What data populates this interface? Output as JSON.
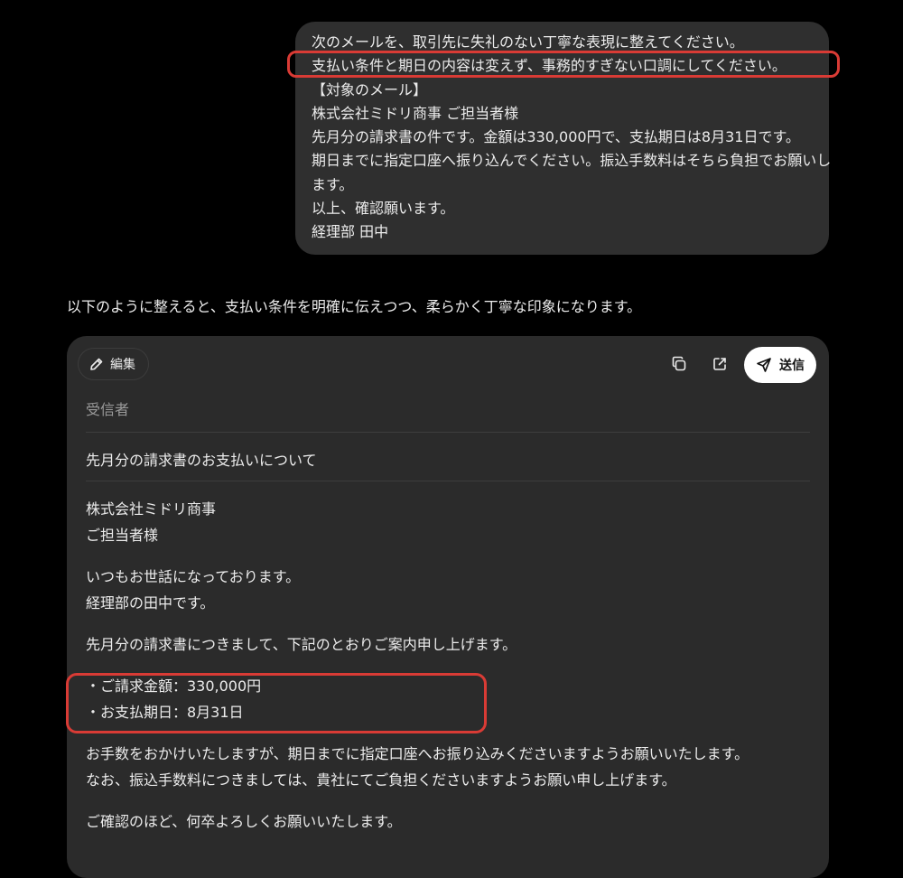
{
  "user_message": {
    "lines": [
      "次のメールを、取引先に失礼のない丁寧な表現に整えてください。",
      "支払い条件と期日の内容は変えず、事務的すぎない口調にしてください。",
      "【対象のメール】",
      "株式会社ミドリ商事 ご担当者様",
      "先月分の請求書の件です。金額は330,000円で、支払期日は8月31日です。",
      "期日までに指定口座へ振り込んでください。振込手数料はそちら負担でお願いし",
      "ます。",
      "以上、確認願います。",
      "経理部 田中"
    ]
  },
  "assistant": {
    "intro": "以下のように整えると、支払い条件を明確に伝えつつ、柔らかく丁寧な印象になります。"
  },
  "email_card": {
    "edit_label": "編集",
    "send_label": "送信",
    "recipient_label": "受信者",
    "subject": "先月分の請求書のお支払いについて",
    "greeting": [
      "株式会社ミドリ商事",
      "ご担当者様"
    ],
    "intro": [
      "いつもお世話になっております。",
      "経理部の田中です。"
    ],
    "lead": "先月分の請求書につきまして、下記のとおりご案内申し上げます。",
    "items": [
      "・ご請求金額：330,000円",
      "・お支払期日：8月31日"
    ],
    "request": [
      "お手数をおかけいたしますが、期日までに指定口座へお振り込みくださいますようお願いいたします。",
      "なお、振込手数料につきましては、貴社にてご負担くださいますようお願い申し上げます。"
    ],
    "closing": "ご確認のほど、何卒よろしくお願いいたします。"
  },
  "colors": {
    "background": "#000000",
    "bubble": "#2f2f2f",
    "card": "#2b2b2b",
    "highlight": "#d93b35"
  }
}
